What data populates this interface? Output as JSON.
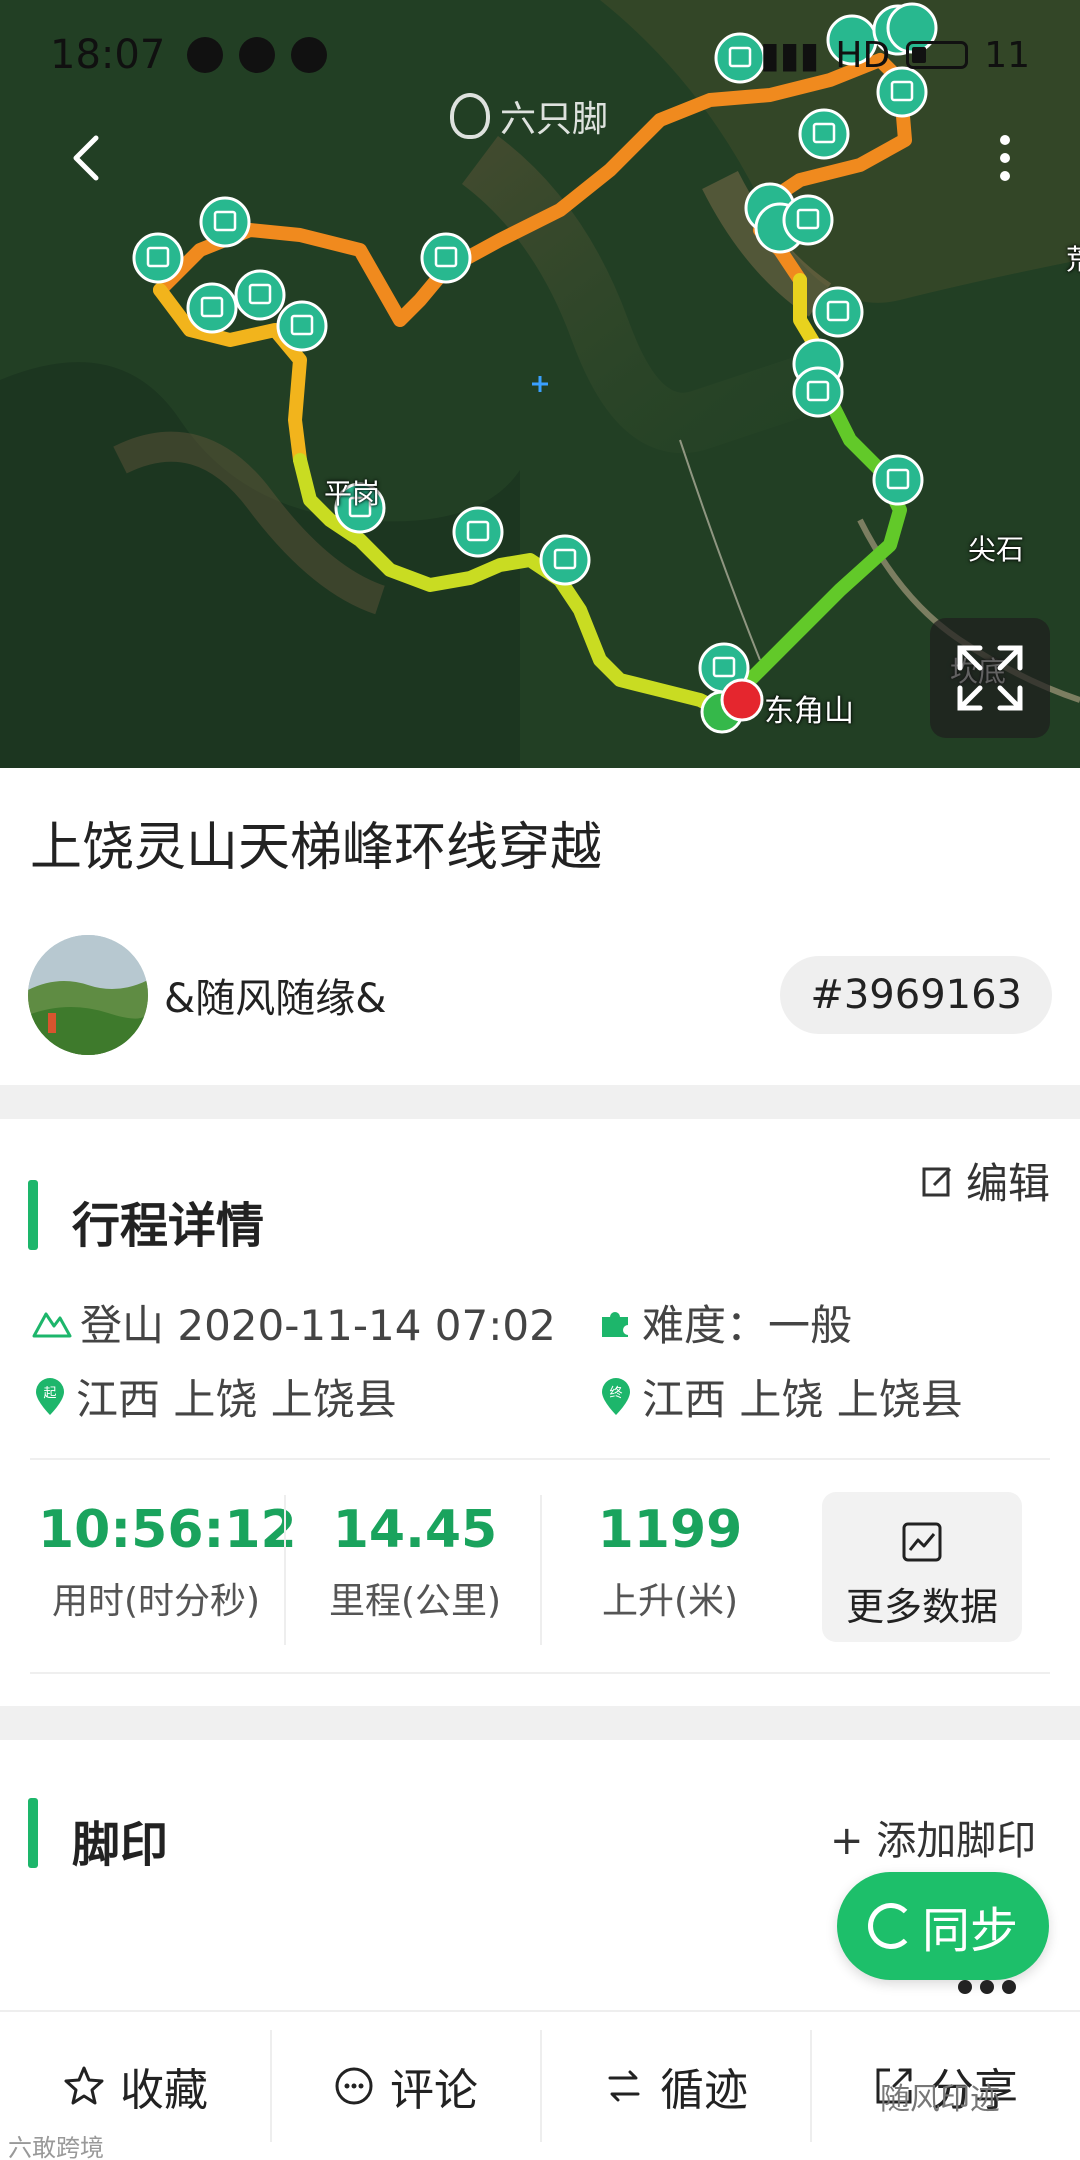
{
  "status_bar": {
    "time": "18:07",
    "signal_text": "HD",
    "battery": "11"
  },
  "map": {
    "watermark": "六只脚",
    "labels": {
      "peak": "东角山",
      "place_right": "尖石",
      "place_left": "平岗",
      "place_bottom_right": "坎底",
      "edge": "荒"
    },
    "markers": {
      "start": "起",
      "end": "终"
    }
  },
  "trip": {
    "title": "上饶灵山天梯峰环线穿越",
    "author": "&随风随缘&",
    "track_id": "#3969163"
  },
  "details": {
    "section_title": "行程详情",
    "edit_label": "编辑",
    "activity": "登山 2020-11-14 07:02",
    "difficulty": "难度：一般",
    "start_location": "江西 上饶 上饶县",
    "end_location": "江西 上饶 上饶县",
    "stats": [
      {
        "value": "10:56:12",
        "label": "用时(时分秒)"
      },
      {
        "value": "14.45",
        "label": "里程(公里)"
      },
      {
        "value": "1199",
        "label": "上升(米)"
      }
    ],
    "more_data_label": "更多数据"
  },
  "footprints": {
    "section_title": "脚印",
    "add_label": "+ 添加脚印",
    "sync_label": "同步"
  },
  "bottom_bar": {
    "favorite": "收藏",
    "comment": "评论",
    "follow_track": "循迹",
    "share": "分享"
  },
  "watermarks": {
    "bottom_left": "六敢跨境",
    "bottom_right": "随风印迹"
  },
  "colors": {
    "accent": "#1db66b",
    "track_start": "#3fbf35",
    "track_end": "#f08a1e"
  }
}
